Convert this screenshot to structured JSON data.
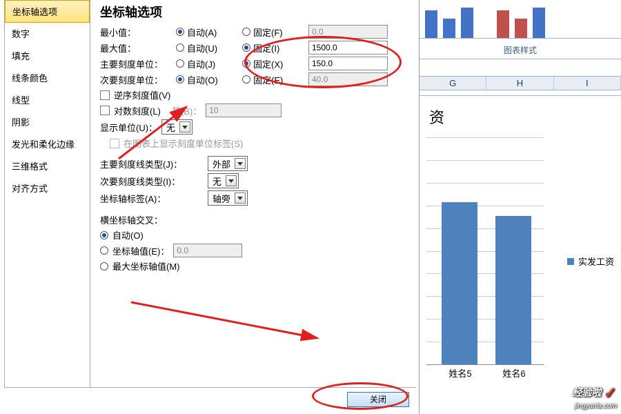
{
  "sidebar": {
    "items": [
      {
        "label": "坐标轴选项"
      },
      {
        "label": "数字"
      },
      {
        "label": "填充"
      },
      {
        "label": "线条颜色"
      },
      {
        "label": "线型"
      },
      {
        "label": "阴影"
      },
      {
        "label": "发光和柔化边缘"
      },
      {
        "label": "三维格式"
      },
      {
        "label": "对齐方式"
      }
    ]
  },
  "content": {
    "heading": "坐标轴选项",
    "min": {
      "label": "最小值：",
      "auto": "自动(A)",
      "fixed": "固定(F)",
      "value": "0.0"
    },
    "max": {
      "label": "最大值：",
      "auto": "自动(U)",
      "fixed": "固定(I)",
      "value": "1500.0"
    },
    "major": {
      "label": "主要刻度单位：",
      "auto": "自动(J)",
      "fixed": "固定(X)",
      "value": "150.0"
    },
    "minor": {
      "label": "次要刻度单位：",
      "auto": "自动(O)",
      "fixed": "固定(E)",
      "value": "40.0"
    },
    "reverse": "逆序刻度值(V)",
    "log": {
      "label": "对数刻度(L)",
      "base_label": "基(B)：",
      "base_value": "10"
    },
    "display_unit": {
      "label": "显示单位(U)：",
      "value": "无"
    },
    "show_unit_label": "在图表上显示刻度单位标签(S)",
    "major_tick": {
      "label": "主要刻度线类型(J)：",
      "value": "外部"
    },
    "minor_tick": {
      "label": "次要刻度线类型(I)：",
      "value": "无"
    },
    "axis_label": {
      "label": "坐标轴标签(A)：",
      "value": "轴旁"
    },
    "cross": {
      "heading": "横坐标轴交叉：",
      "auto": "自动(O)",
      "at": {
        "label": "坐标轴值(E)：",
        "value": "0.0"
      },
      "max": "最大坐标轴值(M)"
    },
    "close": "关闭"
  },
  "ribbon": {
    "group": "图表样式"
  },
  "columns": [
    "G",
    "H",
    "I"
  ],
  "legend": "实发工资",
  "chart_data": {
    "type": "bar",
    "title": "资",
    "categories": [
      "姓名5",
      "姓名6"
    ],
    "values": [
      1070,
      980
    ],
    "series_name": "实发工资",
    "ylim": [
      0,
      1500
    ],
    "major_unit": 150,
    "color": "#4f81bd"
  },
  "watermark": {
    "brand": "经验啦",
    "url": "jingyanla.com"
  }
}
